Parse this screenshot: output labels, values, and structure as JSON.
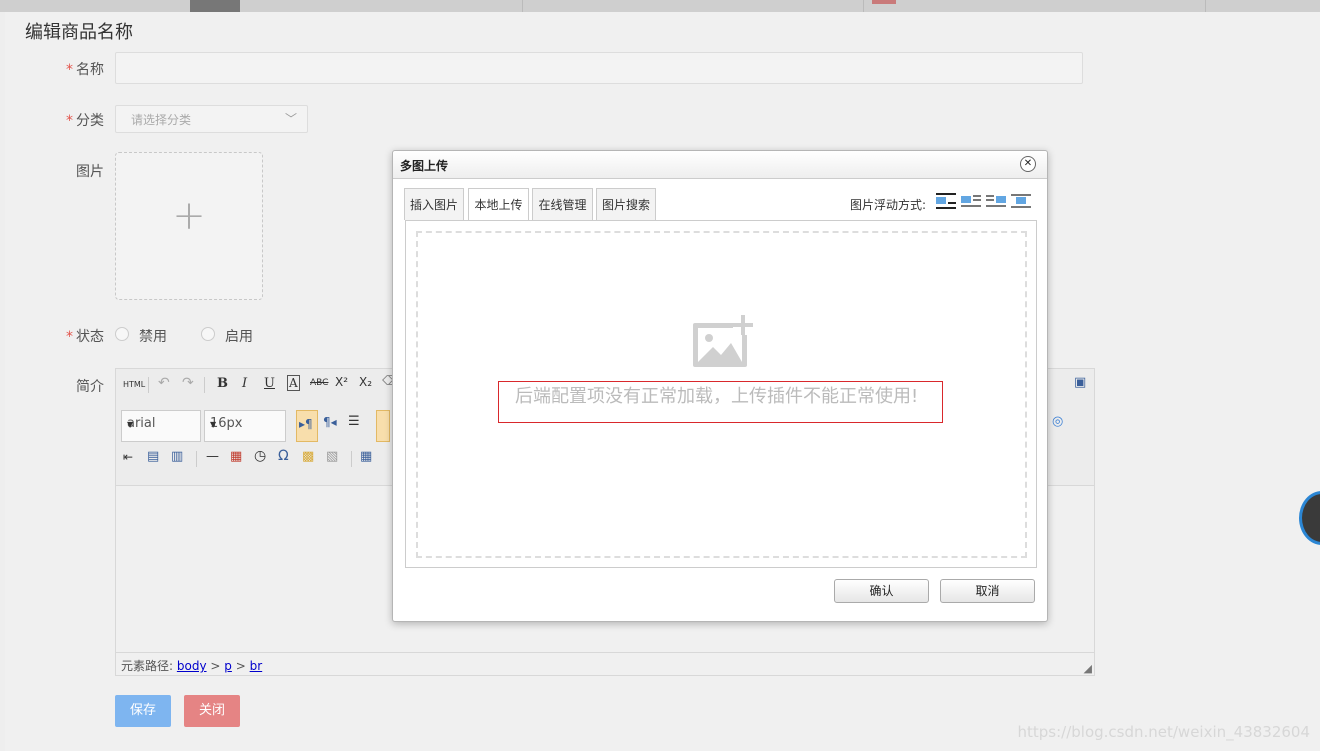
{
  "page": {
    "title": "编辑商品名称",
    "watermark": "https://blog.csdn.net/weixin_43832604"
  },
  "form": {
    "name_label": "名称",
    "category_label": "分类",
    "category_placeholder": "请选择分类",
    "image_label": "图片",
    "status_label": "状态",
    "status_options": [
      "禁用",
      "启用"
    ],
    "intro_label": "简介",
    "required_mark": "*"
  },
  "editor": {
    "font_family": "arial",
    "font_size": "16px",
    "html_btn": "HTML",
    "status_path_label": "元素路径:",
    "path": [
      "body",
      "p",
      "br"
    ],
    "path_sep": ">"
  },
  "actions": {
    "save": "保存",
    "close": "关闭"
  },
  "dialog": {
    "title": "多图上传",
    "close_glyph": "✕",
    "tabs": [
      "插入图片",
      "本地上传",
      "在线管理",
      "图片搜索"
    ],
    "active_tab": "本地上传",
    "float_label": "图片浮动方式:",
    "error": "后端配置项没有正常加载，上传插件不能正常使用!",
    "confirm": "确认",
    "cancel": "取消"
  }
}
